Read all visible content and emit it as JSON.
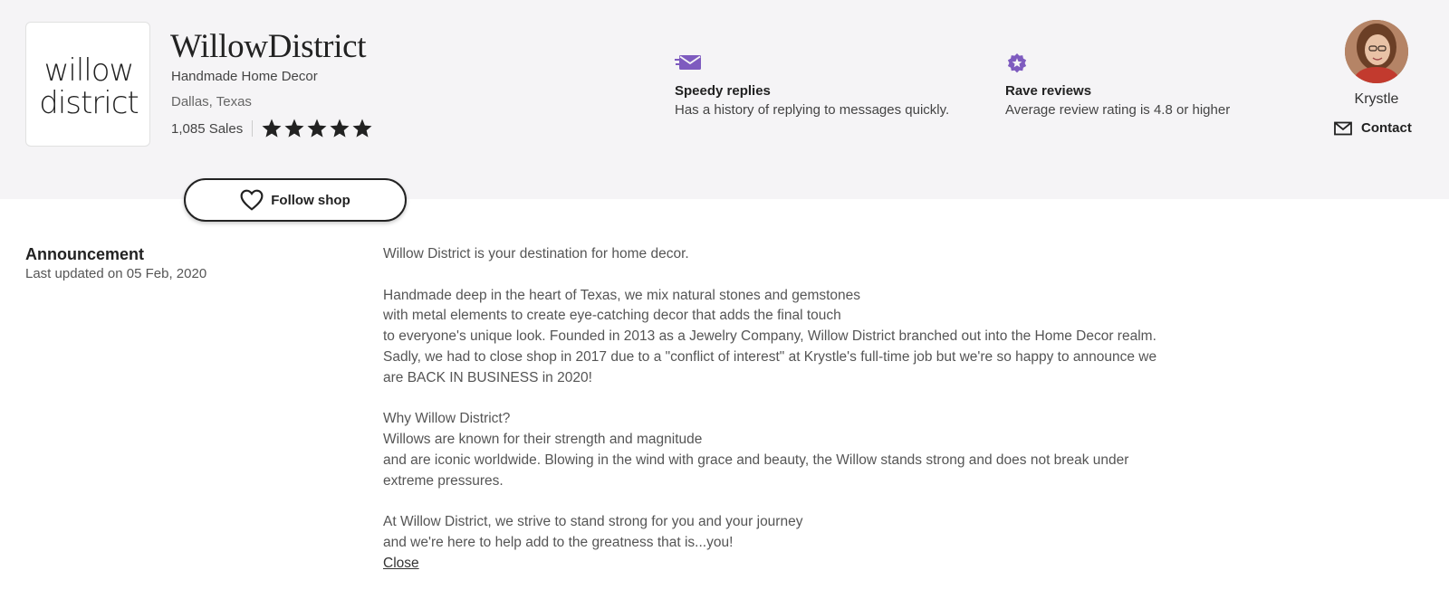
{
  "shop": {
    "logo_text": [
      "willow",
      "district"
    ],
    "name": "WillowDistrict",
    "tagline": "Handmade Home Decor",
    "location": "Dallas, Texas",
    "sales": "1,085 Sales",
    "rating_stars": 5,
    "follow_label": "Follow shop"
  },
  "badges": [
    {
      "icon": "envelope-fast-icon",
      "title": "Speedy replies",
      "description": "Has a history of replying to messages quickly."
    },
    {
      "icon": "star-badge-icon",
      "title": "Rave reviews",
      "description": "Average review rating is 4.8 or higher"
    }
  ],
  "owner": {
    "name": "Krystle",
    "contact_label": "Contact"
  },
  "announcement": {
    "heading": "Announcement",
    "updated": "Last updated on 05 Feb, 2020",
    "lines": [
      "Willow District is your destination for home decor.",
      "",
      "Handmade deep in the heart of Texas, we mix natural stones and gemstones",
      "with metal elements to create eye-catching decor that adds the final touch",
      "to everyone's unique look. Founded in 2013 as a Jewelry Company, Willow District branched out into the Home Decor realm.",
      "Sadly, we had to close shop in 2017 due to a \"conflict of interest\" at Krystle's full-time job but we're so happy to announce we",
      "are BACK IN BUSINESS in 2020!",
      "",
      "Why Willow District?",
      "Willows are known for their strength and magnitude",
      "and are iconic worldwide. Blowing in the wind with grace and beauty, the Willow stands strong and does not break under",
      "extreme pressures.",
      "",
      "At Willow District, we strive to stand strong for you and your journey",
      "and we're here to help add to the greatness that is...you!"
    ],
    "close_label": "Close"
  },
  "colors": {
    "header_background": "#f5f4f6",
    "badge_purple": "#7e5bbf",
    "text_dark": "#222222"
  }
}
